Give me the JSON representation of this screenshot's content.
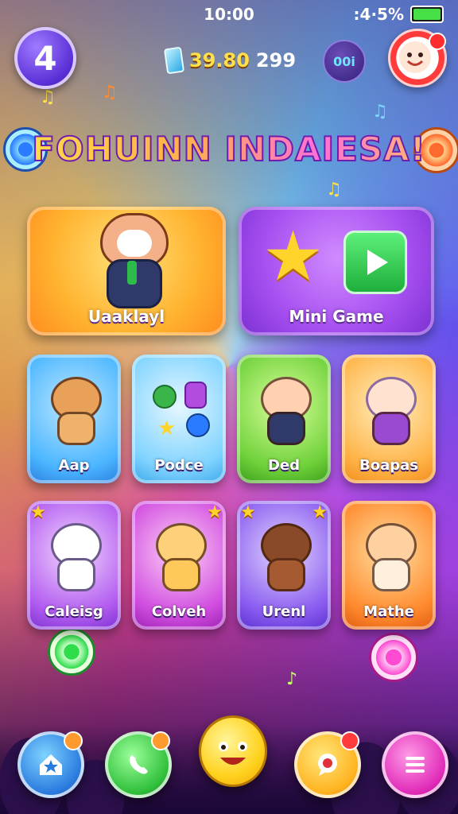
{
  "status_bar": {
    "time": "10:00",
    "battery_text": ":4·5%",
    "battery_level": 0.9
  },
  "top_bar": {
    "level": "4",
    "coins": "39.80",
    "extra_value": "299",
    "chip_label": "00i"
  },
  "title": "FOHUINN INDAIESA!",
  "featured_tile": {
    "label": "Uaaklayl"
  },
  "minigame_tile": {
    "label": "Mini Game"
  },
  "cards_row1": [
    {
      "label": "Aap",
      "color": "#4bb6ff"
    },
    {
      "label": "Podce",
      "color": "#7fd3ff"
    },
    {
      "label": "Ded",
      "color": "#6fd13a"
    },
    {
      "label": "Boapas",
      "color": "#ffb347"
    }
  ],
  "cards_row2": [
    {
      "label": "Caleisg",
      "color": "#b25cf0"
    },
    {
      "label": "Colveh",
      "color": "#d04de0"
    },
    {
      "label": "Urenl",
      "color": "#8a5cf0"
    },
    {
      "label": "Mathe",
      "color": "#ff8a2e"
    }
  ],
  "bottom_nav": {
    "icons": [
      "home-icon",
      "phone-icon",
      "smiley-icon",
      "chat-icon",
      "menu-icon"
    ]
  }
}
